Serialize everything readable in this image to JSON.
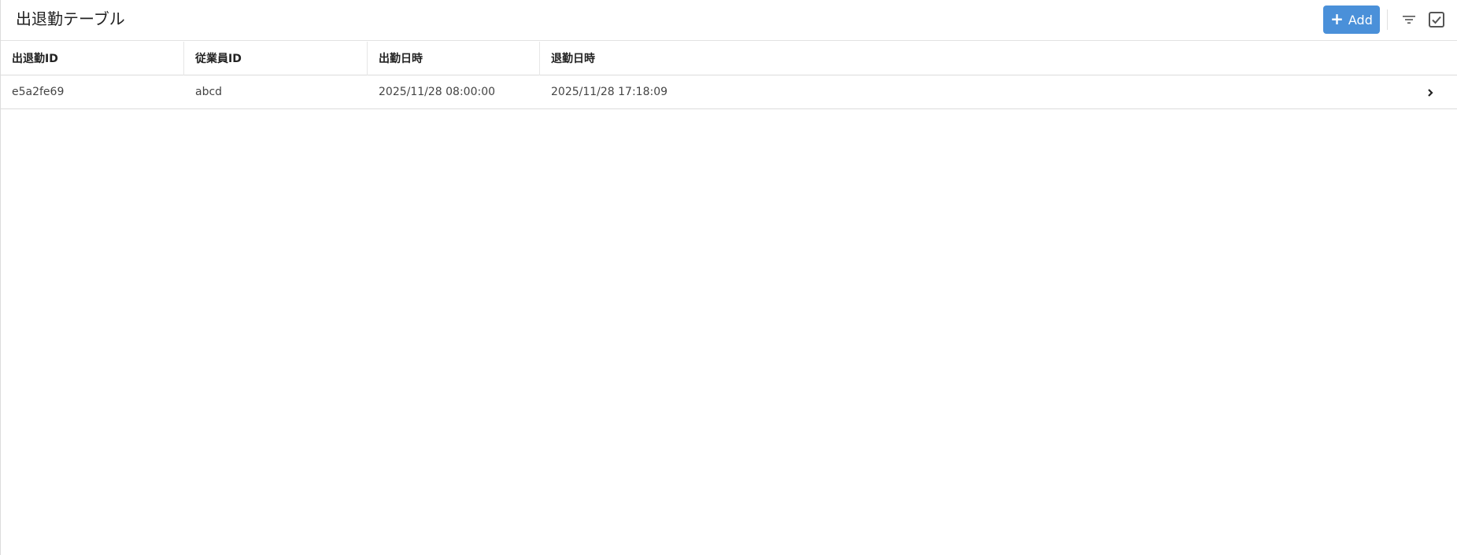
{
  "header": {
    "title": "出退勤テーブル",
    "add_label": "Add",
    "add_icon": "plus-icon",
    "filter_icon": "filter-icon",
    "select_icon": "checkbox-checked-icon"
  },
  "table": {
    "columns": [
      "出退勤ID",
      "従業員ID",
      "出勤日時",
      "退勤日時"
    ],
    "rows": [
      [
        "e5a2fe69",
        "abcd",
        "2025/11/28 08:00:00",
        "2025/11/28 17:18:09"
      ]
    ],
    "row_icon": "chevron-right-icon"
  },
  "colors": {
    "accent": "#4a90d9",
    "border": "#dcdcdc",
    "text": "#333333"
  }
}
